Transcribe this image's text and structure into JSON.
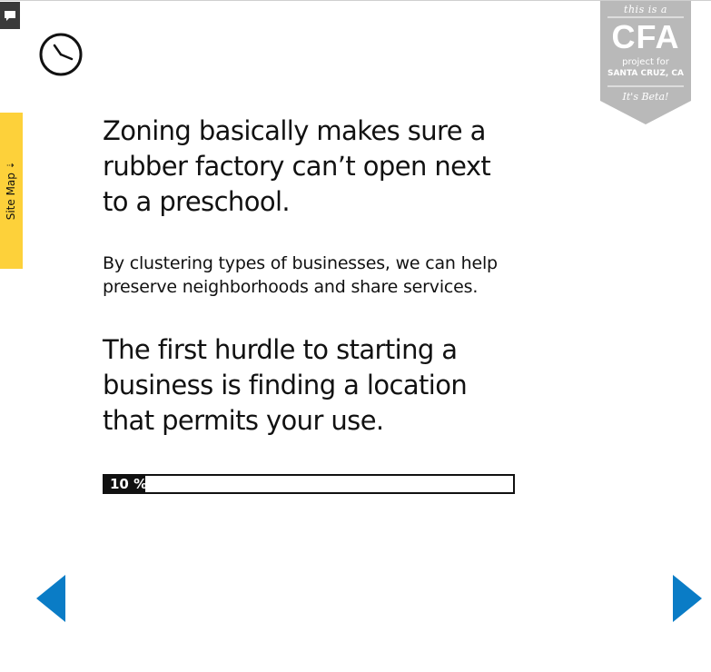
{
  "sidebar": {
    "site_map_label": "Site Map",
    "site_map_arrow": "⇣"
  },
  "badge": {
    "top_text": "this is a",
    "main_text": "CFA",
    "sub_text": "project for",
    "city_text": "SANTA CRUZ, CA",
    "beta_text": "It's Beta!"
  },
  "content": {
    "headline_1": "Zoning basically makes sure a rubber factory can’t open next to a preschool.",
    "body": "By clustering types of businesses, we can help preserve neighborhoods and share services.",
    "headline_2": "The first hurdle to starting a business is finding a location that permits your use."
  },
  "progress": {
    "label": "10 %",
    "percent": 10
  },
  "colors": {
    "accent_blue": "#0a7cc6",
    "site_map_yellow": "#fdd13a",
    "badge_gray": "#b9b9b9",
    "text": "#111111"
  },
  "icons": {
    "feedback": "speech-bubble-icon",
    "clock": "clock-icon",
    "prev": "triangle-left-icon",
    "next": "triangle-right-icon"
  }
}
